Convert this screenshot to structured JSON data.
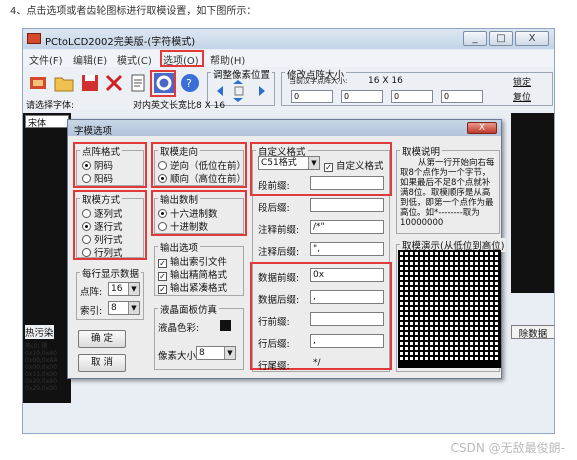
{
  "caption": "4、点击选项或者齿轮图标进行取模设置，如下图所示：",
  "window": {
    "title": "PCtoLCD2002完美版-(字符模式)",
    "controls": [
      "_",
      "□",
      "X"
    ]
  },
  "menu": [
    "文件(F)",
    "编辑(E)",
    "模式(C)",
    "选项(O)",
    "帮助(H)"
  ],
  "toolbar": {
    "adjust_pixel_label": "调整像素位置",
    "modify_size_label": "修改点阵大小",
    "current_size_label": "当前汉字点阵大小:",
    "current_size_value": "16 X 16",
    "confirm_btn": "锁定",
    "reset_btn": "复位",
    "spin_values": [
      "0",
      "0",
      "0",
      "0"
    ],
    "select_font_label": "请选择字体:",
    "font_value": "宋体",
    "font_size_label": "对内英文长宽比8 X 16",
    "icons": [
      "app-icon",
      "open-folder-icon",
      "save-icon",
      "close-x-icon",
      "new-doc-icon",
      "gear-icon",
      "help-icon"
    ]
  },
  "dialog": {
    "title": "字模选项",
    "close_label": "X",
    "dot_format": {
      "title": "点阵格式",
      "options": [
        "阴码",
        "阳码"
      ],
      "selected": 0
    },
    "scan_mode": {
      "title": "取模方式",
      "options": [
        "逐列式",
        "逐行式",
        "列行式",
        "行列式"
      ],
      "selected": 1
    },
    "scan_direction": {
      "title": "取模走向",
      "options": [
        "逆向（低位在前）",
        "顺向（高位在前）"
      ],
      "selected": 1
    },
    "output_base": {
      "title": "输出数制",
      "options": [
        "十六进制数",
        "十进制数"
      ],
      "selected": 0
    },
    "output_opts": {
      "title": "输出选项",
      "items": [
        "输出索引文件",
        "输出精简格式",
        "输出紧凑格式"
      ],
      "checked": [
        true,
        true,
        true
      ]
    },
    "per_row": {
      "title": "每行显示数据",
      "dots_label": "点阵:",
      "dots_value": "16",
      "index_label": "索引:",
      "index_value": "8"
    },
    "lcd_sim": {
      "title": "液晶面板仿真",
      "color_label": "液晶色彩:",
      "pixel_label": "像素大小:",
      "pixel_value": "8"
    },
    "ok_btn": "确 定",
    "cancel_btn": "取 消",
    "custom_format": {
      "title": "自定义格式",
      "combo_value": "C51格式",
      "custom_check": "自定义格式",
      "fields": [
        {
          "label": "段前缀:",
          "value": ""
        },
        {
          "label": "段后缀:",
          "value": ""
        },
        {
          "label": "注释前缀:",
          "value": "/*\""
        },
        {
          "label": "注释后缀:",
          "value": "\","
        },
        {
          "label": "数据前缀:",
          "value": "0x"
        },
        {
          "label": "数据后缀:",
          "value": ","
        },
        {
          "label": "行前缀:",
          "value": ""
        },
        {
          "label": "行后缀:",
          "value": ","
        },
        {
          "label": "行尾缀:",
          "value": "*/"
        }
      ]
    },
    "help": {
      "title": "取模说明",
      "text": "从第一行开始向右每取8个点作为一个字节，如果最后不足8个点就补满8位。取模顺序是从高到低，即第一个点作为最高位。如*--------取为10000000"
    },
    "demo": {
      "title": "取模演示(从低位到高位)"
    }
  },
  "side": {
    "hot_label": "热污染",
    "data_tab": "除数据",
    "hexdump": [
      "热(0) 得",
      "0x10,0x40",
      "0x00,0xAA",
      "0x00,0x00",
      "0x11,0x00",
      "0x20,0x80",
      "0x29,0x00"
    ]
  },
  "watermark": "CSDN @无敌最俊朗-"
}
